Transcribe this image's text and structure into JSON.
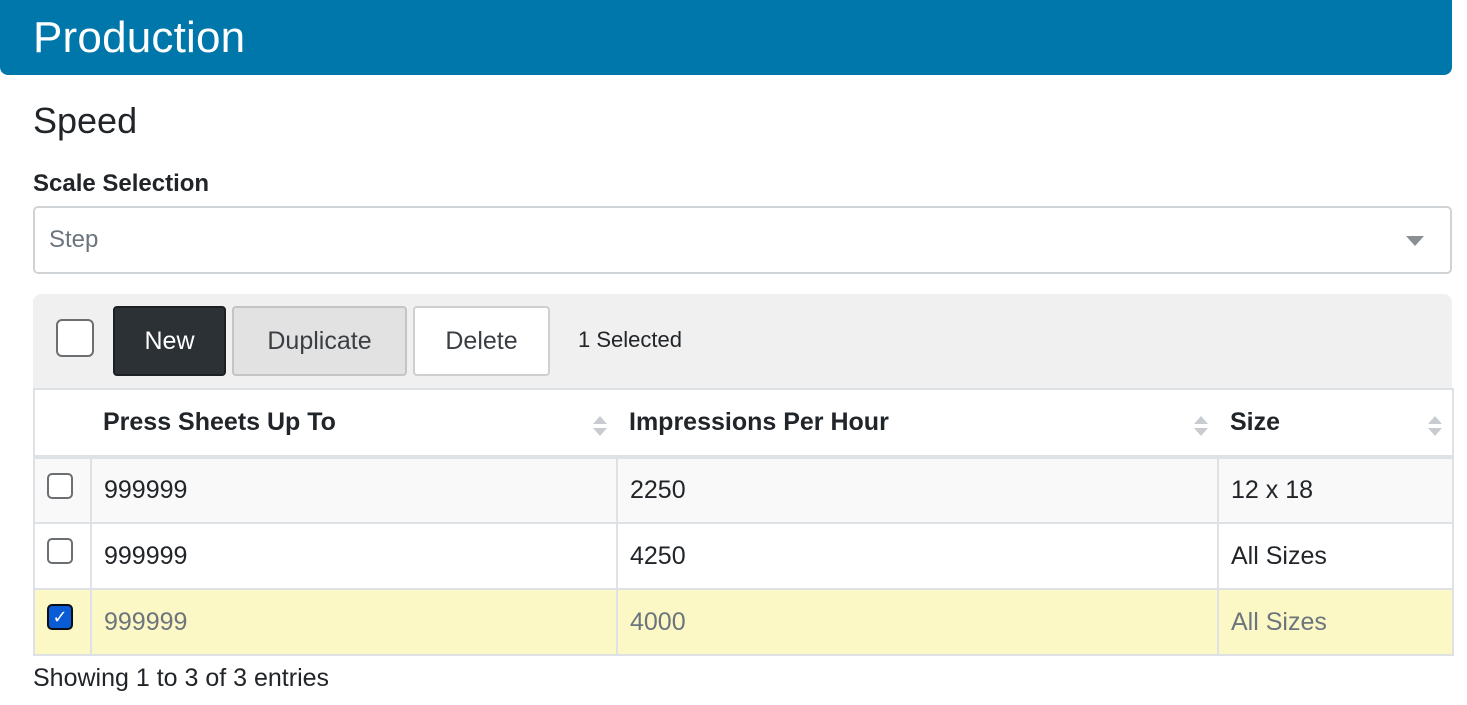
{
  "header": {
    "title": "Production"
  },
  "section": {
    "title": "Speed"
  },
  "scale": {
    "label": "Scale Selection",
    "selected": "Step"
  },
  "toolbar": {
    "new_label": "New",
    "duplicate_label": "Duplicate",
    "delete_label": "Delete",
    "selected_text": "1 Selected"
  },
  "table": {
    "columns": [
      "Press Sheets Up To",
      "Impressions Per Hour",
      "Size"
    ],
    "rows": [
      {
        "checked": false,
        "press_sheets": "999999",
        "impressions": "2250",
        "size": "12 x 18"
      },
      {
        "checked": false,
        "press_sheets": "999999",
        "impressions": "4250",
        "size": "All Sizes"
      },
      {
        "checked": true,
        "press_sheets": "999999",
        "impressions": "4000",
        "size": "All Sizes"
      }
    ]
  },
  "footer": {
    "info": "Showing 1 to 3 of 3 entries"
  },
  "colors": {
    "header_bg": "#0077aa",
    "selected_row": "#fcf8c5",
    "primary_button": "#2c3136"
  },
  "icons": {
    "select_caret": "chevron-down-icon",
    "sort": "sort-icon",
    "checked": "checkmark-icon"
  }
}
